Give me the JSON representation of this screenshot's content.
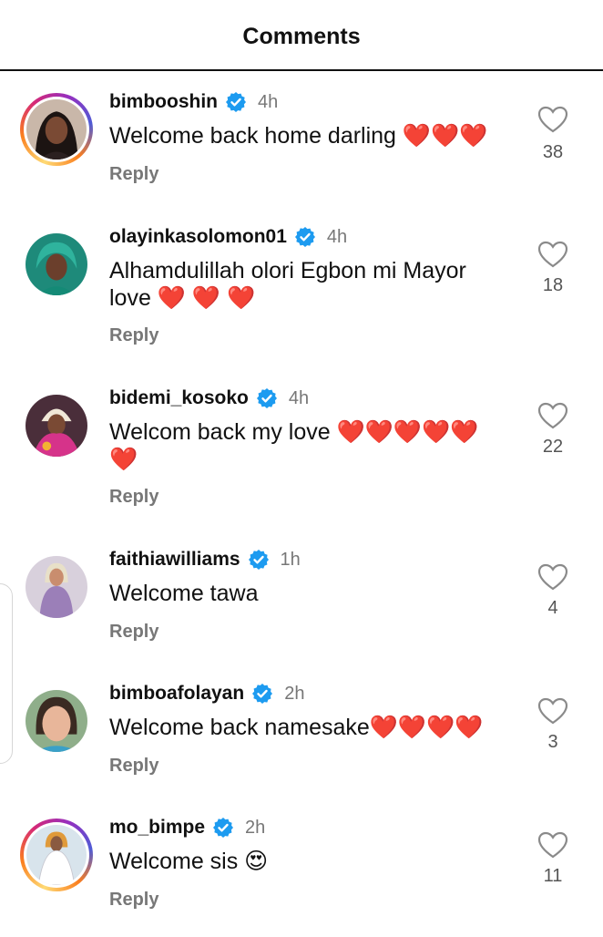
{
  "header": {
    "title": "Comments"
  },
  "comments": [
    {
      "username": "bimbooshin",
      "time": "4h",
      "text": "Welcome back home darling ❤️❤️❤️",
      "reply": "Reply",
      "likes": "38",
      "avatar": "avatar-woman-black-hair",
      "story_ring": true
    },
    {
      "username": "olayinkasolomon01",
      "time": "4h",
      "text": "Alhamdulillah olori Egbon mi Mayor love ❤️ ❤️ ❤️",
      "reply": "Reply",
      "likes": "18",
      "avatar": "avatar-woman-green-scarf",
      "story_ring": false
    },
    {
      "username": "bidemi_kosoko",
      "time": "4h",
      "text": "Welcom back my love ❤️❤️❤️❤️❤️❤️",
      "reply": "Reply",
      "likes": "22",
      "avatar": "avatar-woman-pink-outfit",
      "story_ring": false
    },
    {
      "username": "faithiawilliams",
      "time": "1h",
      "text": "Welcome tawa",
      "reply": "Reply",
      "likes": "4",
      "avatar": "avatar-woman-purple-dress",
      "story_ring": false
    },
    {
      "username": "bimboafolayan",
      "time": "2h",
      "text": "Welcome back namesake❤️❤️❤️❤️",
      "reply": "Reply",
      "likes": "3",
      "avatar": "avatar-woman-close-up",
      "story_ring": false
    },
    {
      "username": "mo_bimpe",
      "time": "2h",
      "text": "Welcome sis 😍",
      "reply": "Reply",
      "likes": "11",
      "avatar": "avatar-woman-white-dress",
      "story_ring": true
    }
  ],
  "colors": {
    "verified": "#1d9bf0",
    "heart": "#d50d18",
    "muted_text": "#777777"
  }
}
